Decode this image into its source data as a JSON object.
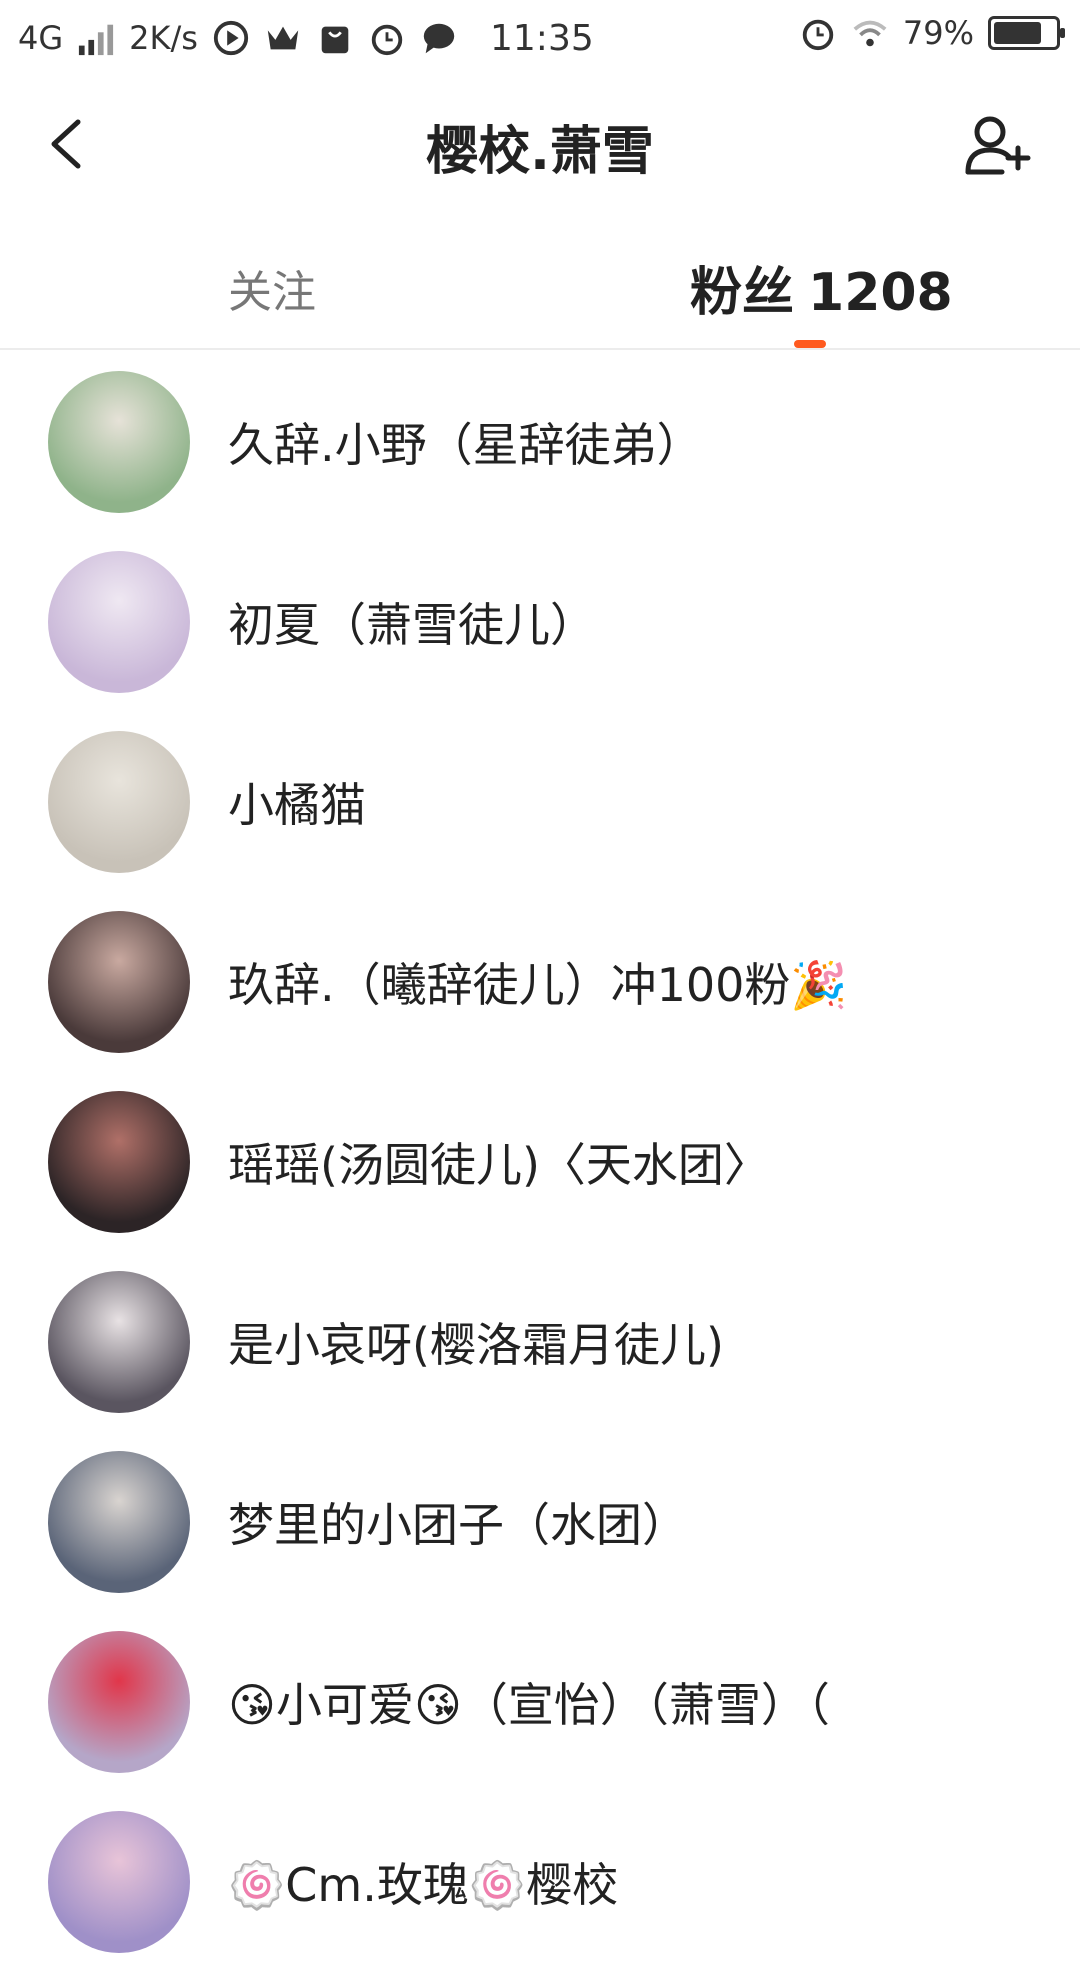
{
  "status_bar": {
    "network": "4G",
    "speed": "2K/s",
    "time": "11:35",
    "battery": "79%",
    "battery_level": 0.79
  },
  "header": {
    "title": "樱校.萧雪"
  },
  "tabs": {
    "follow_label": "关注",
    "fans_label": "粉丝",
    "fans_count": "1208"
  },
  "fans": [
    {
      "name": "久辞.小野（星辞徒弟）",
      "avatar_color": "#8fb38a",
      "avatar_accent": "#e6e2d8"
    },
    {
      "name": "初夏（萧雪徒儿）",
      "avatar_color": "#c9b7d8",
      "avatar_accent": "#efe8f2"
    },
    {
      "name": "小橘猫",
      "avatar_color": "#c8c2b8",
      "avatar_accent": "#e8e4dc"
    },
    {
      "name": "玖辞.（曦辞徒儿）冲100粉🎉",
      "avatar_color": "#4a3a3a",
      "avatar_accent": "#c9a9a0"
    },
    {
      "name": "瑶瑶(汤圆徒儿)〈天水团〉",
      "avatar_color": "#2c2426",
      "avatar_accent": "#b07068"
    },
    {
      "name": "是小哀呀(樱洛霜月徒儿)",
      "avatar_color": "#5a5560",
      "avatar_accent": "#e8e2e4"
    },
    {
      "name": "梦里的小团子（水团）",
      "avatar_color": "#5a6478",
      "avatar_accent": "#d9d4d0"
    },
    {
      "name": "😘小可爱😘（宣怡）（萧雪）（",
      "avatar_color": "#b5a6c8",
      "avatar_accent": "#e1364a"
    },
    {
      "name": "🍥Cm.玫瑰🍥樱校",
      "avatar_color": "#9f90c8",
      "avatar_accent": "#e8c4d8"
    }
  ]
}
